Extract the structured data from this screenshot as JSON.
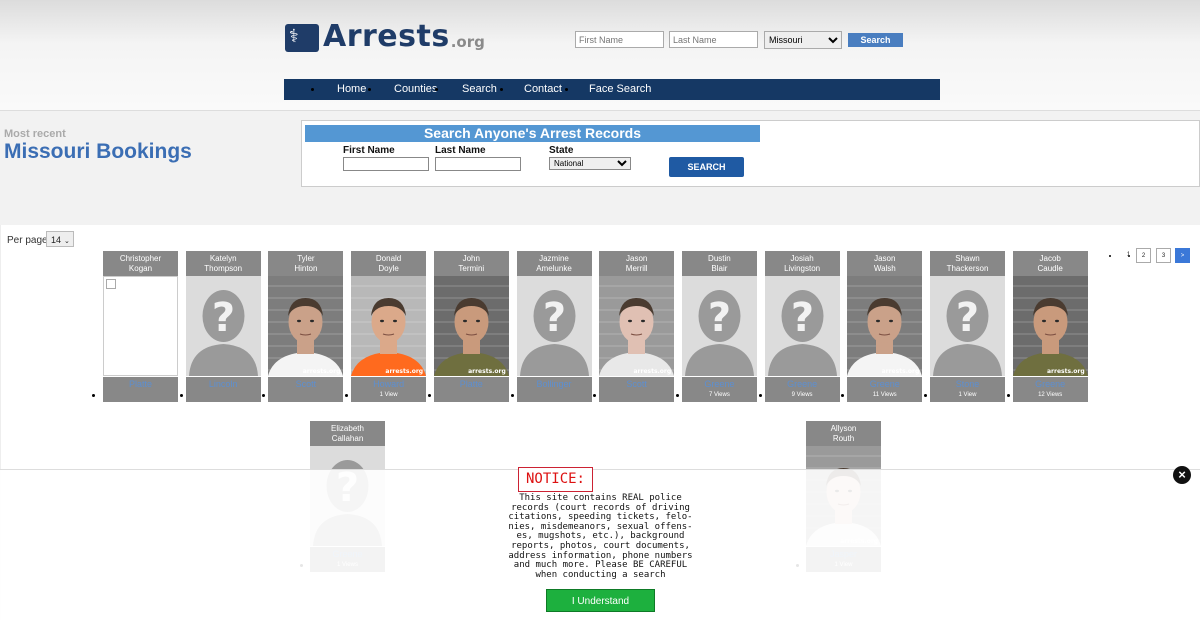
{
  "header": {
    "logo_main": "Arrests",
    "logo_suffix": ".org",
    "first_name_placeholder": "First Name",
    "last_name_placeholder": "Last Name",
    "state_selected": "Missouri",
    "search_label": "Search"
  },
  "nav": {
    "items": [
      "Home",
      "Counties",
      "Search",
      "Contact",
      "Face Search"
    ]
  },
  "banner": {
    "most_recent": "Most recent",
    "title": "Missouri Bookings"
  },
  "search_box": {
    "title": "Search Anyone's Arrest Records",
    "first_label": "First Name",
    "last_label": "Last Name",
    "state_label": "State",
    "state_selected": "National",
    "button": "SEARCH"
  },
  "listing": {
    "per_page_label": "Per page",
    "per_page_value": "14",
    "pages": [
      "1",
      "2",
      "3",
      ">"
    ]
  },
  "bookings": [
    {
      "first": "Christopher",
      "last": "Kogan",
      "county": "Platte",
      "views": "",
      "photo": "broken"
    },
    {
      "first": "Katelyn",
      "last": "Thompson",
      "county": "Lincoln",
      "views": "",
      "photo": "placeholder"
    },
    {
      "first": "Tyler",
      "last": "Hinton",
      "county": "Scott",
      "views": "",
      "photo": "mugshot"
    },
    {
      "first": "Donald",
      "last": "Doyle",
      "county": "Howard",
      "views": "1 View",
      "photo": "mugshot"
    },
    {
      "first": "John",
      "last": "Termini",
      "county": "Platte",
      "views": "",
      "photo": "mugshot"
    },
    {
      "first": "Jazmine",
      "last": "Amelunke",
      "county": "Bollinger",
      "views": "",
      "photo": "placeholder"
    },
    {
      "first": "Jason",
      "last": "Merrill",
      "county": "Scott",
      "views": "",
      "photo": "mugshot"
    },
    {
      "first": "Dustin",
      "last": "Blair",
      "county": "Greene",
      "views": "7 Views",
      "photo": "placeholder"
    },
    {
      "first": "Josiah",
      "last": "Livingston",
      "county": "Greene",
      "views": "9 Views",
      "photo": "placeholder"
    },
    {
      "first": "Jason",
      "last": "Walsh",
      "county": "Greene",
      "views": "11 Views",
      "photo": "mugshot"
    },
    {
      "first": "Shawn",
      "last": "Thackerson",
      "county": "Stone",
      "views": "1 View",
      "photo": "placeholder"
    },
    {
      "first": "Jacob",
      "last": "Caudle",
      "county": "Greene",
      "views": "12 Views",
      "photo": "mugshot"
    },
    {
      "first": "Elizabeth",
      "last": "Callahan",
      "county": "Greene",
      "views": "1 Views",
      "photo": "placeholder"
    },
    {
      "first": "Allyson",
      "last": "Routh",
      "county": "Jasper",
      "views": "1 View",
      "photo": "mugshot"
    }
  ],
  "notice": {
    "title": "NOTICE:",
    "body": "This site contains REAL police records (court records of driving citations, speeding tickets, felo-nies, misdemeanors, sexual offens-es, mugshots, etc.), background reports, photos, court documents, address information, phone numbers and much more. Please BE CAREFUL when conducting a search",
    "button": "I Understand",
    "close": "×"
  },
  "watermark": "arrests.org",
  "colors": {
    "nav_bg": "#153864",
    "brand_blue": "#1f3c68",
    "accent": "#5497d3",
    "understand_green": "#1db03e"
  }
}
